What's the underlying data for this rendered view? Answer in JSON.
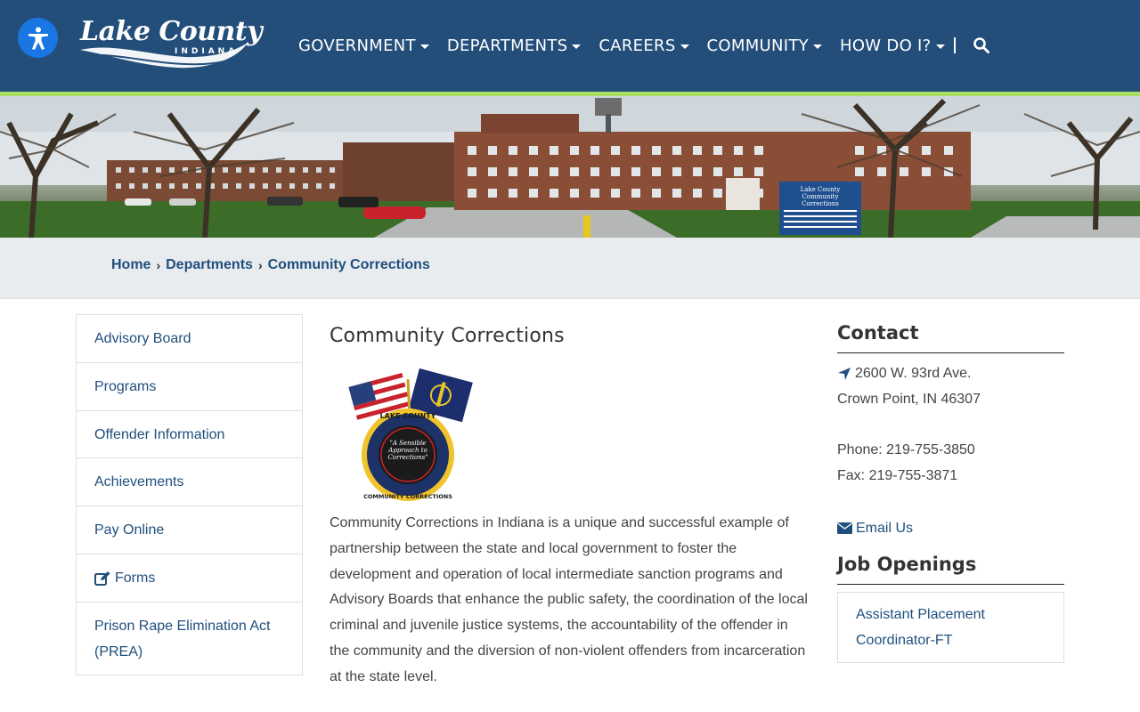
{
  "header": {
    "logo_line1": "Lake County",
    "logo_line2": "INDIANA",
    "nav": [
      {
        "label": "GOVERNMENT"
      },
      {
        "label": "DEPARTMENTS"
      },
      {
        "label": "CAREERS"
      },
      {
        "label": "COMMUNITY"
      },
      {
        "label": "HOW DO I?"
      }
    ],
    "accent_color": "#234e7a",
    "stripe_color": "#a9df62"
  },
  "banner": {
    "sign_line1": "Lake County",
    "sign_line2": "Community",
    "sign_line3": "Corrections"
  },
  "breadcrumb": {
    "items": [
      "Home",
      "Departments",
      "Community Corrections"
    ],
    "separator": "›"
  },
  "sidebar": {
    "items": [
      {
        "label": "Advisory Board"
      },
      {
        "label": "Programs"
      },
      {
        "label": "Offender Information"
      },
      {
        "label": "Achievements"
      },
      {
        "label": "Pay Online"
      },
      {
        "label": "Forms",
        "icon": "edit-icon"
      },
      {
        "label": "Prison Rape Elimination Act (PREA)"
      }
    ]
  },
  "main": {
    "title": "Community Corrections",
    "seal": {
      "top_text": "LAKE COUNTY",
      "motto": "\"A Sensible Approach to Corrections\"",
      "bottom_text": "COMMUNITY CORRECTIONS"
    },
    "body": "Community Corrections in Indiana is a unique and successful example of partnership between the state and local government to foster the development and operation of local intermediate sanction programs and Advisory Boards that enhance the public safety, the coordination of the local criminal and juvenile justice systems, the accountability of the offender in the community and the diversion of non-violent offenders from incarceration at the state level."
  },
  "contact": {
    "title": "Contact",
    "address_line1": "2600 W. 93rd Ave.",
    "address_line2": "Crown Point, IN 46307",
    "phone": "Phone: 219-755-3850",
    "fax": "Fax: 219-755-3871",
    "email_label": "Email Us"
  },
  "jobs": {
    "title": "Job Openings",
    "items": [
      {
        "label": "Assistant Placement Coordinator-FT"
      }
    ]
  }
}
